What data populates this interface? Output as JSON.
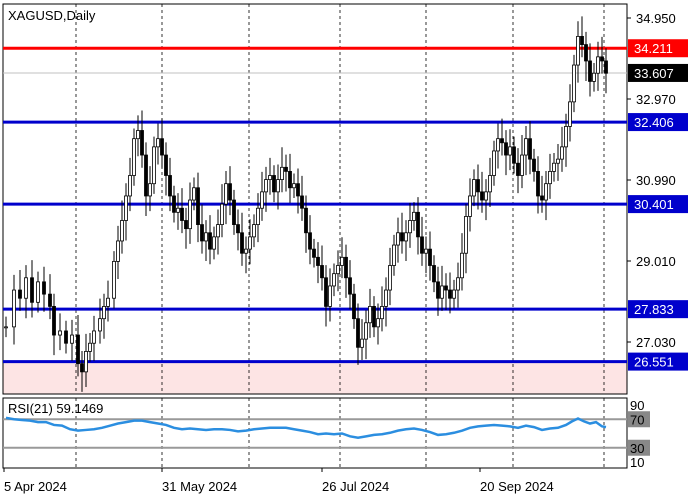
{
  "chart_data": [
    {
      "type": "candlestick",
      "title": "XAGUSD,Daily",
      "y_ticks": [
        "34.950",
        "32.970",
        "30.990",
        "29.010",
        "27.030"
      ],
      "y_values": [
        34.95,
        32.97,
        30.99,
        29.01,
        27.03
      ],
      "x_ticks": [
        "5 Apr 2024",
        "31 May 2024",
        "26 Jul 2024",
        "20 Sep 2024"
      ],
      "current_price": {
        "label": "33.607",
        "value": 33.607,
        "color": "#000000"
      },
      "levels": [
        {
          "label": "34.211",
          "value": 34.211,
          "color": "#ff0000"
        },
        {
          "label": "32.406",
          "value": 32.406,
          "color": "#0000cc"
        },
        {
          "label": "30.401",
          "value": 30.401,
          "color": "#0000cc"
        },
        {
          "label": "27.833",
          "value": 27.833,
          "color": "#0000cc"
        },
        {
          "label": "26.551",
          "value": 26.551,
          "color": "#0000cc"
        }
      ],
      "support_zone": {
        "from": 25.7,
        "to": 26.551,
        "color": "#fde4e4"
      },
      "close_path": [
        [
          0,
          27.4
        ],
        [
          8,
          28.3
        ],
        [
          14,
          28.1
        ],
        [
          20,
          28.6
        ],
        [
          26,
          28.0
        ],
        [
          32,
          28.5
        ],
        [
          38,
          28.2
        ],
        [
          44,
          27.9
        ],
        [
          48,
          27.2
        ],
        [
          54,
          27.3
        ],
        [
          60,
          27.0
        ],
        [
          66,
          27.2
        ],
        [
          72,
          26.5
        ],
        [
          76,
          26.3
        ],
        [
          80,
          26.8
        ],
        [
          84,
          27.0
        ],
        [
          88,
          27.3
        ],
        [
          94,
          27.6
        ],
        [
          98,
          27.9
        ],
        [
          102,
          28.1
        ],
        [
          108,
          29.0
        ],
        [
          112,
          29.5
        ],
        [
          116,
          30.0
        ],
        [
          120,
          30.6
        ],
        [
          124,
          31.1
        ],
        [
          128,
          32.0
        ],
        [
          132,
          32.2
        ],
        [
          136,
          31.6
        ],
        [
          140,
          30.6
        ],
        [
          144,
          30.9
        ],
        [
          148,
          31.8
        ],
        [
          152,
          32.0
        ],
        [
          156,
          31.6
        ],
        [
          160,
          31.1
        ],
        [
          164,
          30.6
        ],
        [
          168,
          30.2
        ],
        [
          172,
          30.3
        ],
        [
          176,
          30.0
        ],
        [
          180,
          29.8
        ],
        [
          184,
          30.5
        ],
        [
          188,
          30.8
        ],
        [
          192,
          29.9
        ],
        [
          196,
          29.5
        ],
        [
          200,
          29.7
        ],
        [
          204,
          29.3
        ],
        [
          208,
          29.6
        ],
        [
          212,
          29.9
        ],
        [
          216,
          30.4
        ],
        [
          220,
          30.9
        ],
        [
          224,
          30.5
        ],
        [
          228,
          29.9
        ],
        [
          232,
          29.7
        ],
        [
          236,
          29.2
        ],
        [
          240,
          29.3
        ],
        [
          244,
          29.6
        ],
        [
          248,
          29.9
        ],
        [
          252,
          30.3
        ],
        [
          256,
          30.7
        ],
        [
          260,
          31.0
        ],
        [
          264,
          31.1
        ],
        [
          268,
          30.7
        ],
        [
          272,
          31.0
        ],
        [
          276,
          31.3
        ],
        [
          280,
          31.2
        ],
        [
          284,
          30.8
        ],
        [
          288,
          30.9
        ],
        [
          292,
          30.6
        ],
        [
          296,
          30.3
        ],
        [
          300,
          29.7
        ],
        [
          304,
          29.3
        ],
        [
          308,
          29.1
        ],
        [
          312,
          28.9
        ],
        [
          316,
          28.6
        ],
        [
          320,
          27.9
        ],
        [
          324,
          28.4
        ],
        [
          328,
          28.7
        ],
        [
          332,
          28.9
        ],
        [
          336,
          29.1
        ],
        [
          340,
          28.6
        ],
        [
          344,
          28.2
        ],
        [
          348,
          27.6
        ],
        [
          352,
          26.9
        ],
        [
          356,
          27.1
        ],
        [
          360,
          27.5
        ],
        [
          364,
          27.9
        ],
        [
          368,
          27.4
        ],
        [
          372,
          27.6
        ],
        [
          376,
          27.9
        ],
        [
          380,
          28.3
        ],
        [
          384,
          28.9
        ],
        [
          388,
          29.4
        ],
        [
          392,
          29.7
        ],
        [
          396,
          29.5
        ],
        [
          400,
          29.7
        ],
        [
          404,
          30.0
        ],
        [
          408,
          30.2
        ],
        [
          412,
          29.6
        ],
        [
          416,
          29.2
        ],
        [
          420,
          29.3
        ],
        [
          424,
          28.9
        ],
        [
          428,
          28.5
        ],
        [
          432,
          28.1
        ],
        [
          436,
          28.4
        ],
        [
          440,
          28.3
        ],
        [
          444,
          28.1
        ],
        [
          448,
          28.3
        ],
        [
          452,
          28.6
        ],
        [
          456,
          29.2
        ],
        [
          460,
          30.1
        ],
        [
          464,
          30.6
        ],
        [
          468,
          31.0
        ],
        [
          472,
          30.7
        ],
        [
          476,
          30.5
        ],
        [
          480,
          30.7
        ],
        [
          484,
          31.1
        ],
        [
          488,
          31.7
        ],
        [
          492,
          32.0
        ],
        [
          496,
          31.9
        ],
        [
          500,
          31.6
        ],
        [
          504,
          31.8
        ],
        [
          508,
          31.4
        ],
        [
          512,
          31.1
        ],
        [
          516,
          31.6
        ],
        [
          520,
          32.0
        ],
        [
          524,
          31.5
        ],
        [
          528,
          31.2
        ],
        [
          532,
          30.6
        ],
        [
          536,
          30.5
        ],
        [
          540,
          30.9
        ],
        [
          544,
          31.2
        ],
        [
          548,
          31.4
        ],
        [
          552,
          31.5
        ],
        [
          556,
          31.8
        ],
        [
          560,
          32.3
        ],
        [
          564,
          32.9
        ],
        [
          568,
          33.8
        ],
        [
          572,
          34.5
        ],
        [
          576,
          34.3
        ],
        [
          580,
          33.9
        ],
        [
          584,
          33.4
        ],
        [
          588,
          33.6
        ],
        [
          592,
          34.0
        ],
        [
          596,
          33.9
        ],
        [
          600,
          33.6
        ]
      ],
      "rsi": {
        "label": "RSI(21) 59.1469",
        "levels": [
          "70",
          "30"
        ],
        "scale_ticks": [
          "90",
          "10"
        ],
        "line_color": "#2b8ee0",
        "values": [
          [
            0,
            72
          ],
          [
            8,
            70
          ],
          [
            16,
            69
          ],
          [
            24,
            68
          ],
          [
            32,
            66
          ],
          [
            40,
            66
          ],
          [
            48,
            62
          ],
          [
            56,
            61
          ],
          [
            64,
            56
          ],
          [
            72,
            54
          ],
          [
            80,
            55
          ],
          [
            88,
            56
          ],
          [
            96,
            58
          ],
          [
            104,
            61
          ],
          [
            112,
            64
          ],
          [
            120,
            66
          ],
          [
            128,
            68
          ],
          [
            136,
            68
          ],
          [
            144,
            66
          ],
          [
            152,
            64
          ],
          [
            160,
            62
          ],
          [
            168,
            58
          ],
          [
            176,
            56
          ],
          [
            184,
            57
          ],
          [
            192,
            56
          ],
          [
            200,
            55
          ],
          [
            208,
            56
          ],
          [
            216,
            56
          ],
          [
            224,
            55
          ],
          [
            232,
            53
          ],
          [
            240,
            54
          ],
          [
            248,
            56
          ],
          [
            256,
            57
          ],
          [
            264,
            58
          ],
          [
            272,
            58
          ],
          [
            280,
            58
          ],
          [
            288,
            56
          ],
          [
            296,
            54
          ],
          [
            304,
            52
          ],
          [
            312,
            49
          ],
          [
            320,
            50
          ],
          [
            328,
            49
          ],
          [
            336,
            50
          ],
          [
            344,
            46
          ],
          [
            352,
            44
          ],
          [
            360,
            46
          ],
          [
            368,
            48
          ],
          [
            376,
            49
          ],
          [
            384,
            51
          ],
          [
            392,
            54
          ],
          [
            400,
            56
          ],
          [
            408,
            57
          ],
          [
            416,
            55
          ],
          [
            424,
            52
          ],
          [
            432,
            48
          ],
          [
            440,
            49
          ],
          [
            448,
            51
          ],
          [
            456,
            54
          ],
          [
            464,
            58
          ],
          [
            472,
            60
          ],
          [
            480,
            61
          ],
          [
            488,
            62
          ],
          [
            496,
            61
          ],
          [
            504,
            60
          ],
          [
            512,
            58
          ],
          [
            520,
            61
          ],
          [
            528,
            59
          ],
          [
            536,
            55
          ],
          [
            544,
            57
          ],
          [
            552,
            58
          ],
          [
            560,
            62
          ],
          [
            566,
            67
          ],
          [
            572,
            71
          ],
          [
            578,
            67
          ],
          [
            584,
            64
          ],
          [
            590,
            66
          ],
          [
            596,
            60
          ],
          [
            600,
            59
          ]
        ]
      }
    }
  ]
}
